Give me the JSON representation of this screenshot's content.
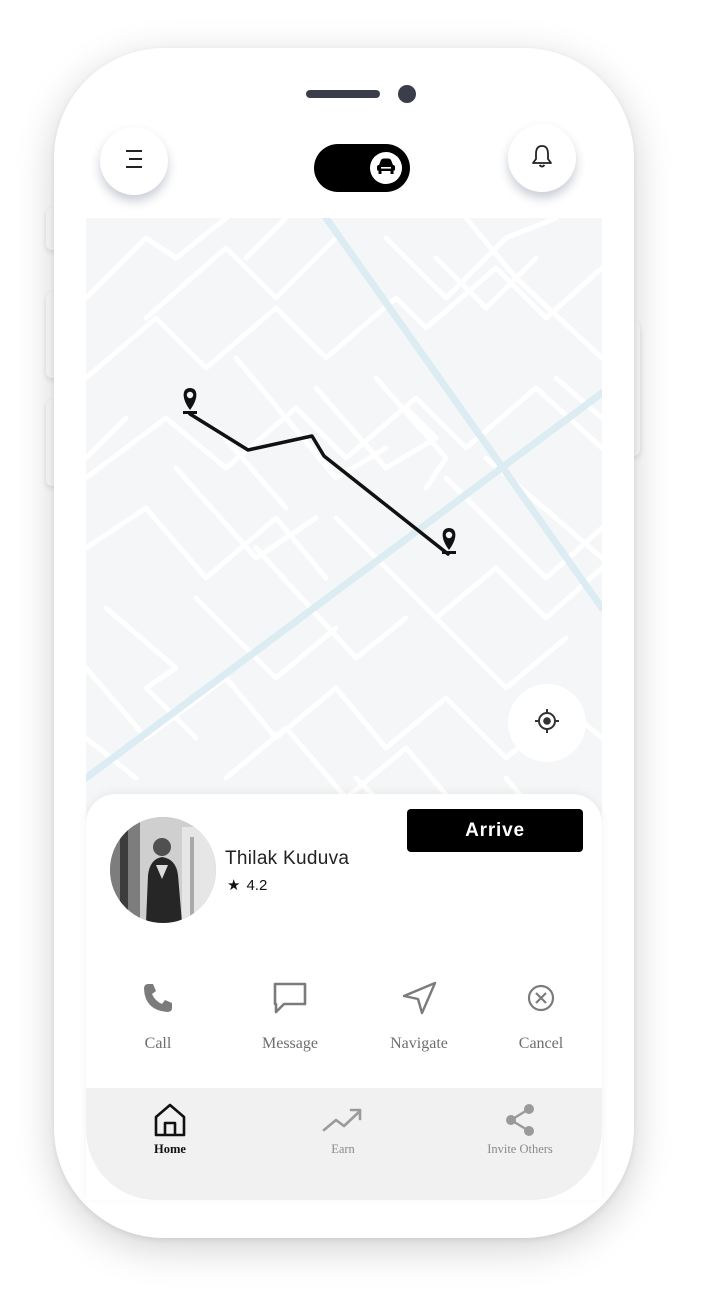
{
  "header": {
    "menu_icon": "menu-icon",
    "toggle_icon": "car-icon",
    "notification_icon": "bell-icon"
  },
  "map": {
    "route_color": "#111111",
    "road_color": "#ffffff",
    "highway_color": "#dbeef5",
    "locate_icon": "crosshair-icon"
  },
  "driver": {
    "name": "Thilak Kuduva",
    "rating_star": "★",
    "rating": "4.2"
  },
  "arrive_label": "Arrive",
  "actions": [
    {
      "label": "Call",
      "icon": "phone-icon"
    },
    {
      "label": "Message",
      "icon": "message-icon"
    },
    {
      "label": "Navigate",
      "icon": "navigate-icon"
    },
    {
      "label": "Cancel",
      "icon": "cancel-icon"
    }
  ],
  "tabs": [
    {
      "label": "Home",
      "icon": "home-icon",
      "active": true
    },
    {
      "label": "Earn",
      "icon": "trending-up-icon",
      "active": false
    },
    {
      "label": "Invite Others",
      "icon": "share-icon",
      "active": false
    }
  ],
  "colors": {
    "accent": "#000000",
    "muted": "#6e6e6e",
    "tabbar_bg": "#f1f1f1"
  }
}
